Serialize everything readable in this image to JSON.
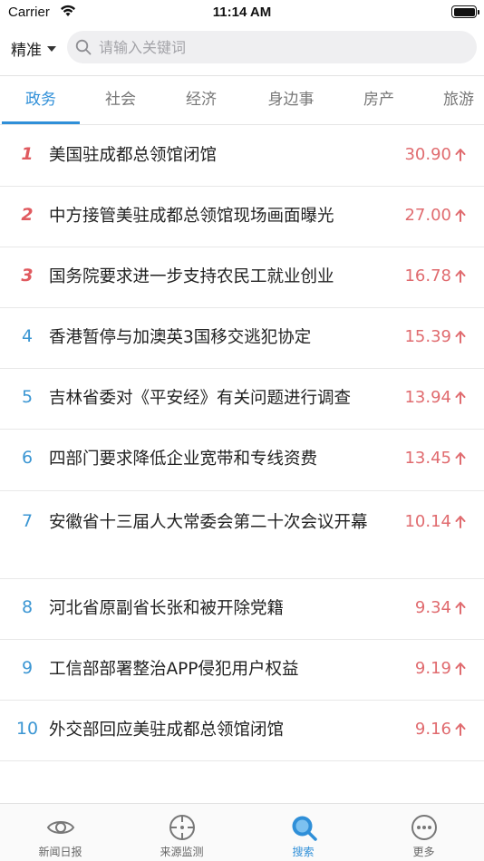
{
  "status_bar": {
    "carrier": "Carrier",
    "time": "11:14 AM"
  },
  "search": {
    "mode": "精准",
    "placeholder": "请输入关键词"
  },
  "categories": [
    {
      "label": "政务",
      "active": true
    },
    {
      "label": "社会",
      "active": false
    },
    {
      "label": "经济",
      "active": false
    },
    {
      "label": "身边事",
      "active": false
    },
    {
      "label": "房产",
      "active": false
    },
    {
      "label": "旅游",
      "active": false
    }
  ],
  "list": [
    {
      "rank": "1",
      "title": "美国驻成都总领馆闭馆",
      "score": "30.90"
    },
    {
      "rank": "2",
      "title": "中方接管美驻成都总领馆现场画面曝光",
      "score": "27.00"
    },
    {
      "rank": "3",
      "title": "国务院要求进一步支持农民工就业创业",
      "score": "16.78"
    },
    {
      "rank": "4",
      "title": "香港暂停与加澳英3国移交逃犯协定",
      "score": "15.39"
    },
    {
      "rank": "5",
      "title": "吉林省委对《平安经》有关问题进行调查",
      "score": "13.94"
    },
    {
      "rank": "6",
      "title": "四部门要求降低企业宽带和专线资费",
      "score": "13.45"
    },
    {
      "rank": "7",
      "title": "安徽省十三届人大常委会第二十次会议开幕",
      "score": "10.14"
    },
    {
      "rank": "8",
      "title": "河北省原副省长张和被开除党籍",
      "score": "9.34"
    },
    {
      "rank": "9",
      "title": "工信部部署整治APP侵犯用户权益",
      "score": "9.19"
    },
    {
      "rank": "10",
      "title": "外交部回应美驻成都总领馆闭馆",
      "score": "9.16"
    }
  ],
  "tab_bar": [
    {
      "label": "新闻日报",
      "icon": "eye-icon",
      "active": false
    },
    {
      "label": "来源监测",
      "icon": "crosshair-icon",
      "active": false
    },
    {
      "label": "搜索",
      "icon": "search-icon",
      "active": true
    },
    {
      "label": "更多",
      "icon": "more-icon",
      "active": false
    }
  ],
  "colors": {
    "accent": "#2f8fd8",
    "hot_rank": "#e05a5f",
    "score": "#e06b6f",
    "normal_rank": "#3b96d3"
  }
}
